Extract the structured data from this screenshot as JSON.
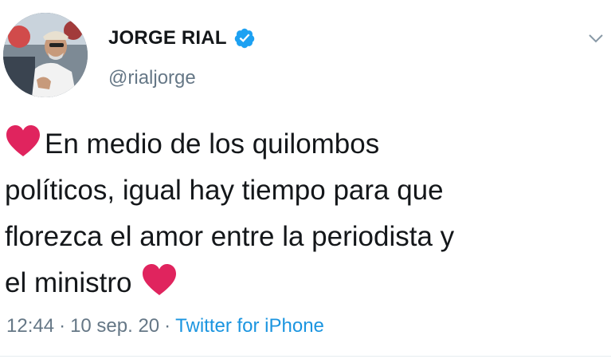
{
  "tweet": {
    "author": {
      "display_name": "JORGE RIAL",
      "handle": "@rialjorge",
      "verified": true,
      "avatar_icon": "profile-photo"
    },
    "text_lines": [
      "En medio de los quilombos",
      "políticos, igual hay tiempo para que",
      "florezca el amor entre la periodista y",
      "el ministro"
    ],
    "emoji": "heart-emoji",
    "meta": {
      "time": "12:44",
      "date": "10 sep. 20",
      "source": "Twitter for iPhone",
      "separator": "·"
    },
    "menu_icon": "chevron-down-icon"
  },
  "colors": {
    "text": "#14171a",
    "secondary": "#657786",
    "link": "#1b95e0",
    "verified_badge": "#1da1f2",
    "heart": "#e0245e"
  }
}
